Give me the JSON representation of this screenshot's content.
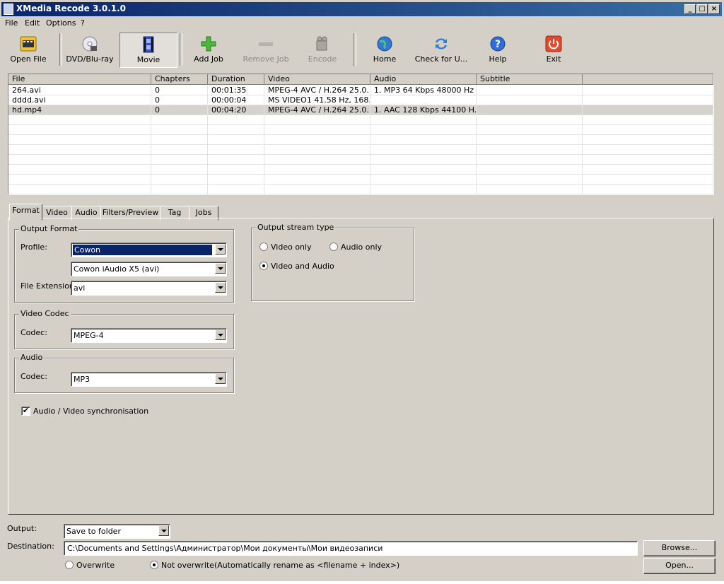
{
  "window": {
    "title": "XMedia Recode 3.0.1.0",
    "minimize": "_",
    "maximize": "□",
    "close": "×"
  },
  "menu": [
    "File",
    "Edit",
    "Options",
    "?"
  ],
  "toolbar": {
    "open_file": "Open File",
    "dvd": "DVD/Blu-ray",
    "movie": "Movie",
    "add_job": "Add Job",
    "remove_job": "Remove Job",
    "encode": "Encode",
    "home": "Home",
    "check": "Check for U...",
    "help": "Help",
    "exit": "Exit"
  },
  "files": {
    "columns": [
      "File",
      "Chapters",
      "Duration",
      "Video",
      "Audio",
      "Subtitle"
    ],
    "rows": [
      {
        "file": "264.avi",
        "chapters": "0",
        "duration": "00:01:35",
        "video": "MPEG-4 AVC / H.264 25.0...",
        "audio": "1. MP3 64 Kbps 48000 Hz ...",
        "subtitle": ""
      },
      {
        "file": "dddd.avi",
        "chapters": "0",
        "duration": "00:00:04",
        "video": "MS VIDEO1 41.58 Hz, 168...",
        "audio": "",
        "subtitle": ""
      },
      {
        "file": "hd.mp4",
        "chapters": "0",
        "duration": "00:04:20",
        "video": "MPEG-4 AVC / H.264 25.0...",
        "audio": "1. AAC 128 Kbps 44100 H...",
        "subtitle": ""
      }
    ],
    "selected_row": 2
  },
  "tabs": [
    "Format",
    "Video",
    "Audio",
    "Filters/Preview",
    "Tag",
    "Jobs"
  ],
  "format": {
    "output_format": {
      "legend": "Output Format",
      "profile_label": "Profile:",
      "profile": "Cowon",
      "device": "Cowon iAudio X5 (avi)",
      "ext_label": "File Extension:",
      "ext": "avi"
    },
    "video_codec": {
      "legend": "Video Codec",
      "codec_label": "Codec:",
      "codec": "MPEG-4"
    },
    "audio": {
      "legend": "Audio",
      "codec_label": "Codec:",
      "codec": "MP3"
    },
    "stream": {
      "legend": "Output stream type",
      "video_only": "Video only",
      "audio_only": "Audio only",
      "video_and_audio": "Video and Audio",
      "selected": "video_and_audio"
    },
    "sync": {
      "label": "Audio / Video synchronisation",
      "checked": true
    }
  },
  "output": {
    "label": "Output:",
    "value": "Save to folder",
    "destination_label": "Destination:",
    "destination": "C:\\Documents and Settings\\Администратор\\Мои документы\\Мои видеозаписи",
    "browse": "Browse...",
    "open": "Open...",
    "overwrite": "Overwrite",
    "not_overwrite": "Not overwrite(Automatically rename as <filename + index>)",
    "selected": "not_overwrite"
  }
}
